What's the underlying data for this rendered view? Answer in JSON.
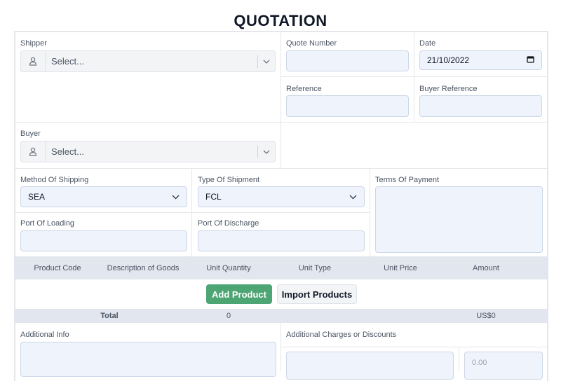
{
  "title": "QUOTATION",
  "shipper": {
    "label": "Shipper",
    "placeholder": "Select..."
  },
  "buyer": {
    "label": "Buyer",
    "placeholder": "Select..."
  },
  "quote_number": {
    "label": "Quote Number",
    "value": ""
  },
  "date": {
    "label": "Date",
    "value": "21/10/2022"
  },
  "reference": {
    "label": "Reference",
    "value": ""
  },
  "buyer_reference": {
    "label": "Buyer Reference",
    "value": ""
  },
  "method_of_shipping": {
    "label": "Method Of Shipping",
    "value": "SEA"
  },
  "type_of_shipment": {
    "label": "Type Of Shipment",
    "value": "FCL"
  },
  "terms_of_payment": {
    "label": "Terms Of Payment",
    "value": ""
  },
  "port_of_loading": {
    "label": "Port Of Loading",
    "value": ""
  },
  "port_of_discharge": {
    "label": "Port Of Discharge",
    "value": ""
  },
  "table": {
    "columns": [
      "Product Code",
      "Description of Goods",
      "Unit Quantity",
      "Unit Type",
      "Unit Price",
      "Amount"
    ]
  },
  "buttons": {
    "add_product": "Add Product",
    "import_products": "Import Products"
  },
  "total": {
    "label": "Total",
    "quantity": "0",
    "amount": "US$0"
  },
  "additional_info": {
    "label": "Additional Info"
  },
  "additional_charges": {
    "label": "Additional Charges or Discounts",
    "amount_placeholder": "0.00"
  },
  "colors": {
    "accent": "#4ea574",
    "input_bg": "#eef3fc",
    "table_header_bg": "#e2e6ee"
  }
}
